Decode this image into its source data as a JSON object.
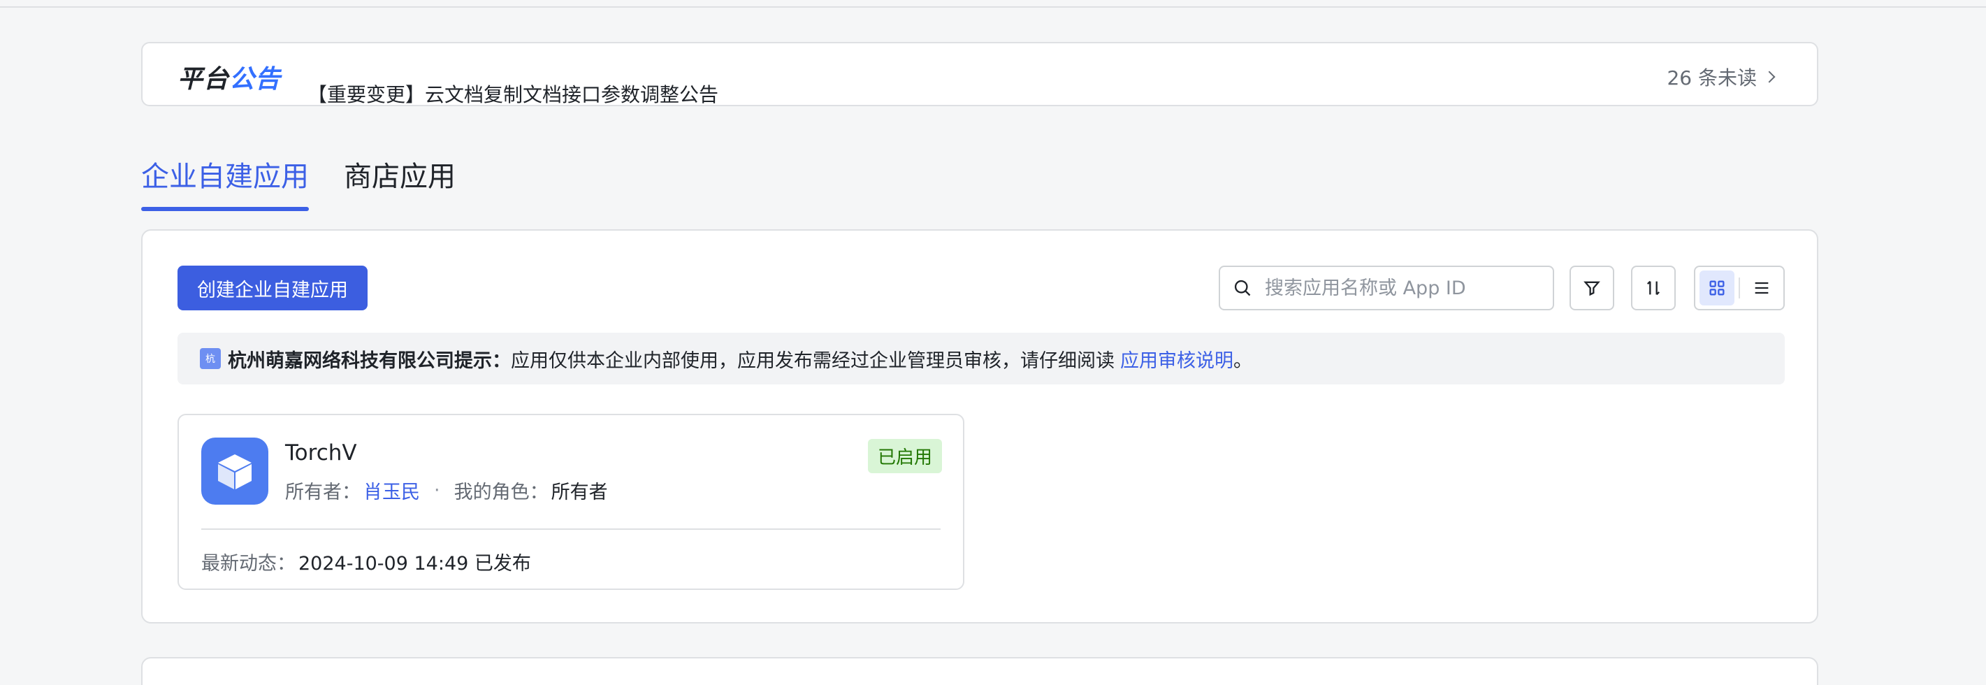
{
  "announcement": {
    "logo_part1": "平台",
    "logo_part2": "公告",
    "title": "【重要变更】云文档复制文档接口参数调整公告",
    "unread": "26 条未读"
  },
  "tabs": [
    {
      "label": "企业自建应用",
      "active": true
    },
    {
      "label": "商店应用",
      "active": false
    }
  ],
  "toolbar": {
    "create_label": "创建企业自建应用",
    "search_placeholder": "搜索应用名称或 App ID"
  },
  "tip": {
    "icon_char": "杭",
    "company": "杭州萌嘉网络科技有限公司提示：",
    "text": "应用仅供本企业内部使用，应用发布需经过企业管理员审核，请仔细阅读",
    "link": "应用审核说明",
    "end": "。"
  },
  "apps": [
    {
      "name": "TorchV",
      "owner_label": "所有者：",
      "owner": "肖玉民",
      "separator": "·",
      "role_label": "我的角色：",
      "role": "所有者",
      "status": "已启用",
      "activity_label": "最新动态：",
      "activity": "2024-10-09 14:49 已发布"
    }
  ],
  "colors": {
    "accent": "#3c60e6",
    "status_bg": "#d9f5d6",
    "status_text": "#237804"
  }
}
